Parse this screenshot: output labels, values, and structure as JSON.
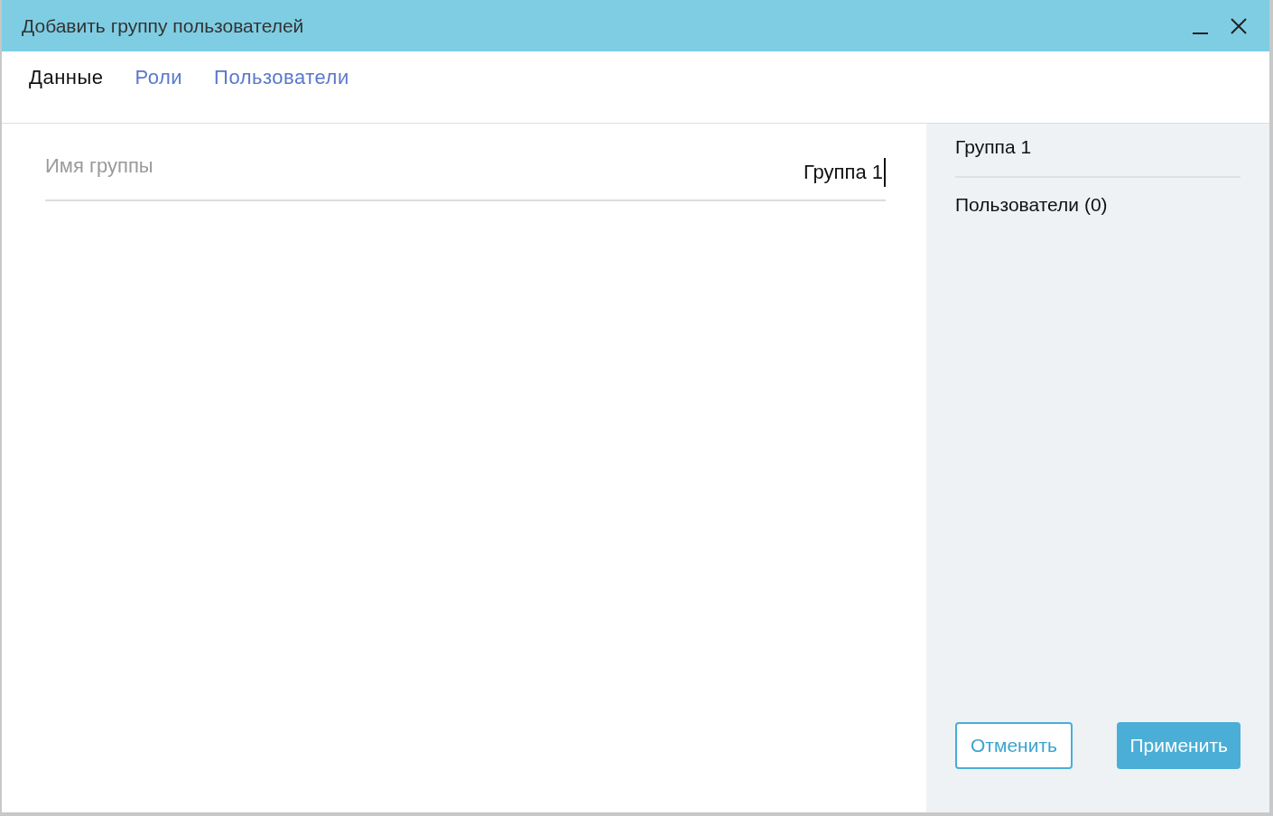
{
  "window": {
    "title": "Добавить группу пользователей"
  },
  "tabs": [
    {
      "label": "Данные",
      "selected": true
    },
    {
      "label": "Роли",
      "selected": false
    },
    {
      "label": "Пользователи",
      "selected": false
    }
  ],
  "field": {
    "label": "Имя группы",
    "value": "Группа 1"
  },
  "summary": {
    "items": [
      "Группа 1",
      "Пользователи (0)"
    ]
  },
  "buttons": [
    {
      "label": "Отменить",
      "kind": "outline"
    },
    {
      "label": "Применить",
      "kind": "primary"
    }
  ]
}
